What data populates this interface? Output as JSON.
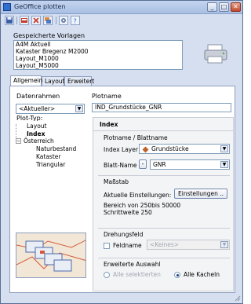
{
  "window": {
    "title": "GeOffice plotten",
    "buttons": {
      "minimize": "_",
      "maximize": "□",
      "close": "✕"
    }
  },
  "toolbar": {
    "items": [
      "save",
      "print-setup",
      "delete",
      "layers",
      "settings",
      "help"
    ]
  },
  "saved_templates": {
    "label": "Gespeicherte Vorlagen",
    "items": [
      "A4M Aktuell",
      "Kataster Bregenz M2000",
      "Layout_M1000",
      "Layout_M5000"
    ]
  },
  "tabs": [
    {
      "label": "Allgemein",
      "active": true
    },
    {
      "label": "Layout",
      "active": false
    },
    {
      "label": "Erweitert",
      "active": false
    }
  ],
  "datenrahmen": {
    "label": "Datenrahmen",
    "value": "<Aktueller>"
  },
  "plotname": {
    "label": "Plotname",
    "value": "IND_Grundstücke_GNR"
  },
  "plot_typ": {
    "label": "Plot-Typ:",
    "tree": [
      {
        "label": "Layout",
        "level": 1,
        "selected": false
      },
      {
        "label": "Index",
        "level": 1,
        "selected": true
      },
      {
        "label": "Österreich",
        "level": 0,
        "selected": false
      },
      {
        "label": "Naturbestand",
        "level": 2,
        "selected": false
      },
      {
        "label": "Kataster",
        "level": 2,
        "selected": false
      },
      {
        "label": "Triangular",
        "level": 2,
        "selected": false
      }
    ]
  },
  "index_panel": {
    "title": "Index",
    "plotname_blattname": "Plotname / Blattname",
    "index_layer_label": "Index Layer",
    "index_layer_value": "Grundstücke",
    "blatt_name_label": "Blatt-Name",
    "blatt_name_prefix": "-",
    "blatt_name_value": "GNR",
    "massstab_title": "Maßstab",
    "aktuelle_label": "Aktuelle Einstellungen:",
    "einstellungen_button": "Einstellungen ..",
    "bereich_text": "Bereich von 250bis 50000",
    "schrittweite_text": "Schrittweite 250",
    "drehungsfeld_title": "Drehungsfeld",
    "feldname_label": "Feldname",
    "feldname_value": "<Keines>",
    "erweiterte_title": "Erweiterte Auswahl",
    "alle_selektierten": "Alle selektierten",
    "alle_kacheln": "Alle Kacheln"
  },
  "colors": {
    "window_bg": "#d6dff0",
    "title_bar": "#b8cbe9",
    "accent": "#2f6fd0",
    "layer_icon": "#c0602b"
  }
}
